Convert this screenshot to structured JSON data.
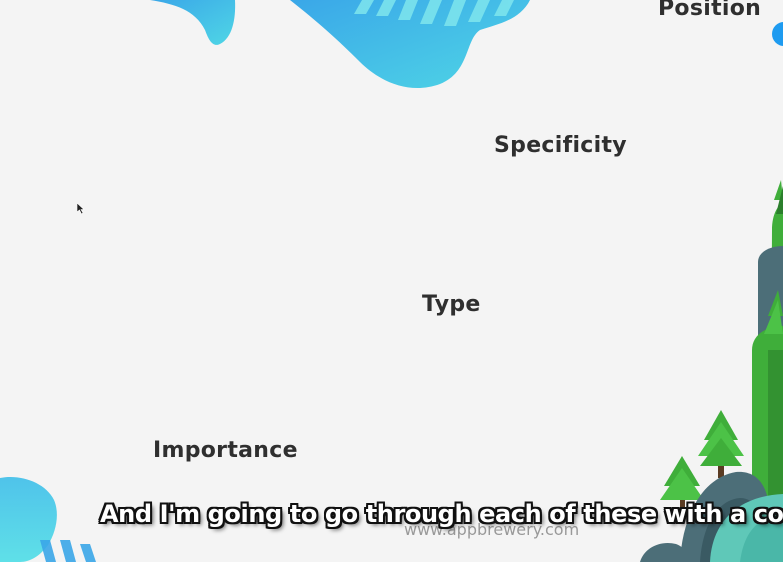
{
  "slide": {
    "labels": {
      "position": "Position",
      "specificity": "Specificity",
      "type": "Type",
      "importance": "Importance"
    },
    "watermark": "www.appbrewery.com",
    "subtitle": "And I'm going to go through each of these with a code"
  },
  "colors": {
    "background": "#f4f4f4",
    "blob_light": "#4fd6e6",
    "blob_dark": "#3aa7e8",
    "tree_green": "#3fae3a",
    "tree_dark": "#2b7f2c",
    "rock": "#4c6e78",
    "accent_dot": "#1e9bf0"
  },
  "icons": {
    "cursor": "mouse-pointer-icon"
  }
}
